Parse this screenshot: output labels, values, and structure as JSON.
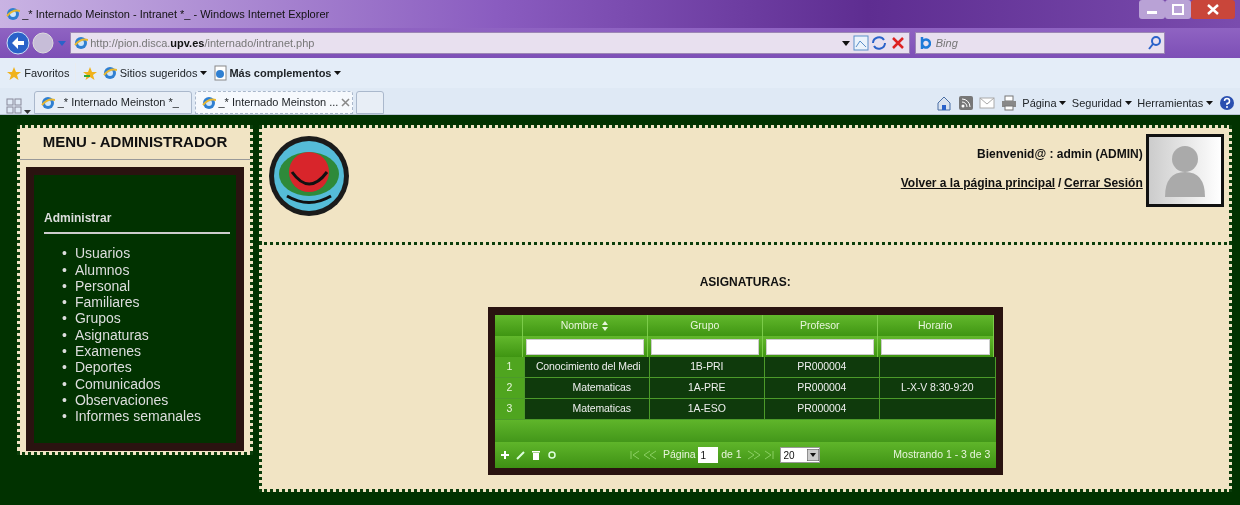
{
  "browser": {
    "title": "_* Internado Meinston - Intranet *_ - Windows Internet Explorer",
    "address": "http://pion.disca.**upv.es**/internado/intranet.php",
    "search_placeholder": "Bing",
    "favorites": [
      {
        "label": "Favoritos",
        "kind": "star"
      },
      {
        "label": "Sitios sugeridos",
        "kind": "ie"
      },
      {
        "label": "Más complementos",
        "kind": "page"
      }
    ],
    "tabs": [
      {
        "label": "_* Internado Meinston *_",
        "selected": false
      },
      {
        "label": "_* Internado Meinston ...",
        "selected": true
      }
    ],
    "commands": [
      "Página",
      "Seguridad",
      "Herramientas"
    ]
  },
  "menu": {
    "title": "MENU - ADMINISTRADOR",
    "section": "Administrar",
    "bullet": "•",
    "items": [
      "Usuarios",
      "Alumnos",
      "Personal",
      "Familiares",
      "Grupos",
      "Asignaturas",
      "Examenes",
      "Deportes",
      "Comunicados",
      "Observaciones",
      "Informes semanales"
    ]
  },
  "header": {
    "welcome": "Bienvenid@ : admin (ADMIN)",
    "links": [
      "Volver a la página principal",
      "Cerrar Sesión"
    ],
    "separator": "/"
  },
  "content": {
    "title": "ASIGNATURAS:",
    "grid": {
      "columns": [
        {
          "label": "Nombre",
          "sorted": true
        },
        {
          "label": "Grupo",
          "sorted": false
        },
        {
          "label": "Profesor",
          "sorted": false
        },
        {
          "label": "Horario",
          "sorted": false
        }
      ],
      "rows": [
        {
          "number": "1",
          "cells": [
            "Conocimiento del Medi",
            "1B-PRI",
            "PR000004",
            null
          ]
        },
        {
          "number": "2",
          "cells": [
            "Matematicas",
            "1A-PRE",
            "PR000004",
            "L-X-V 8:30-9:20"
          ]
        },
        {
          "number": "3",
          "cells": [
            "Matematicas",
            "1A-ESO",
            "PR000004",
            null
          ]
        }
      ],
      "pager": {
        "page_label": "Página",
        "page": "1",
        "of": "de 1",
        "page_size": "20",
        "info": "Mostrando 1 - 3 de 3"
      }
    }
  }
}
